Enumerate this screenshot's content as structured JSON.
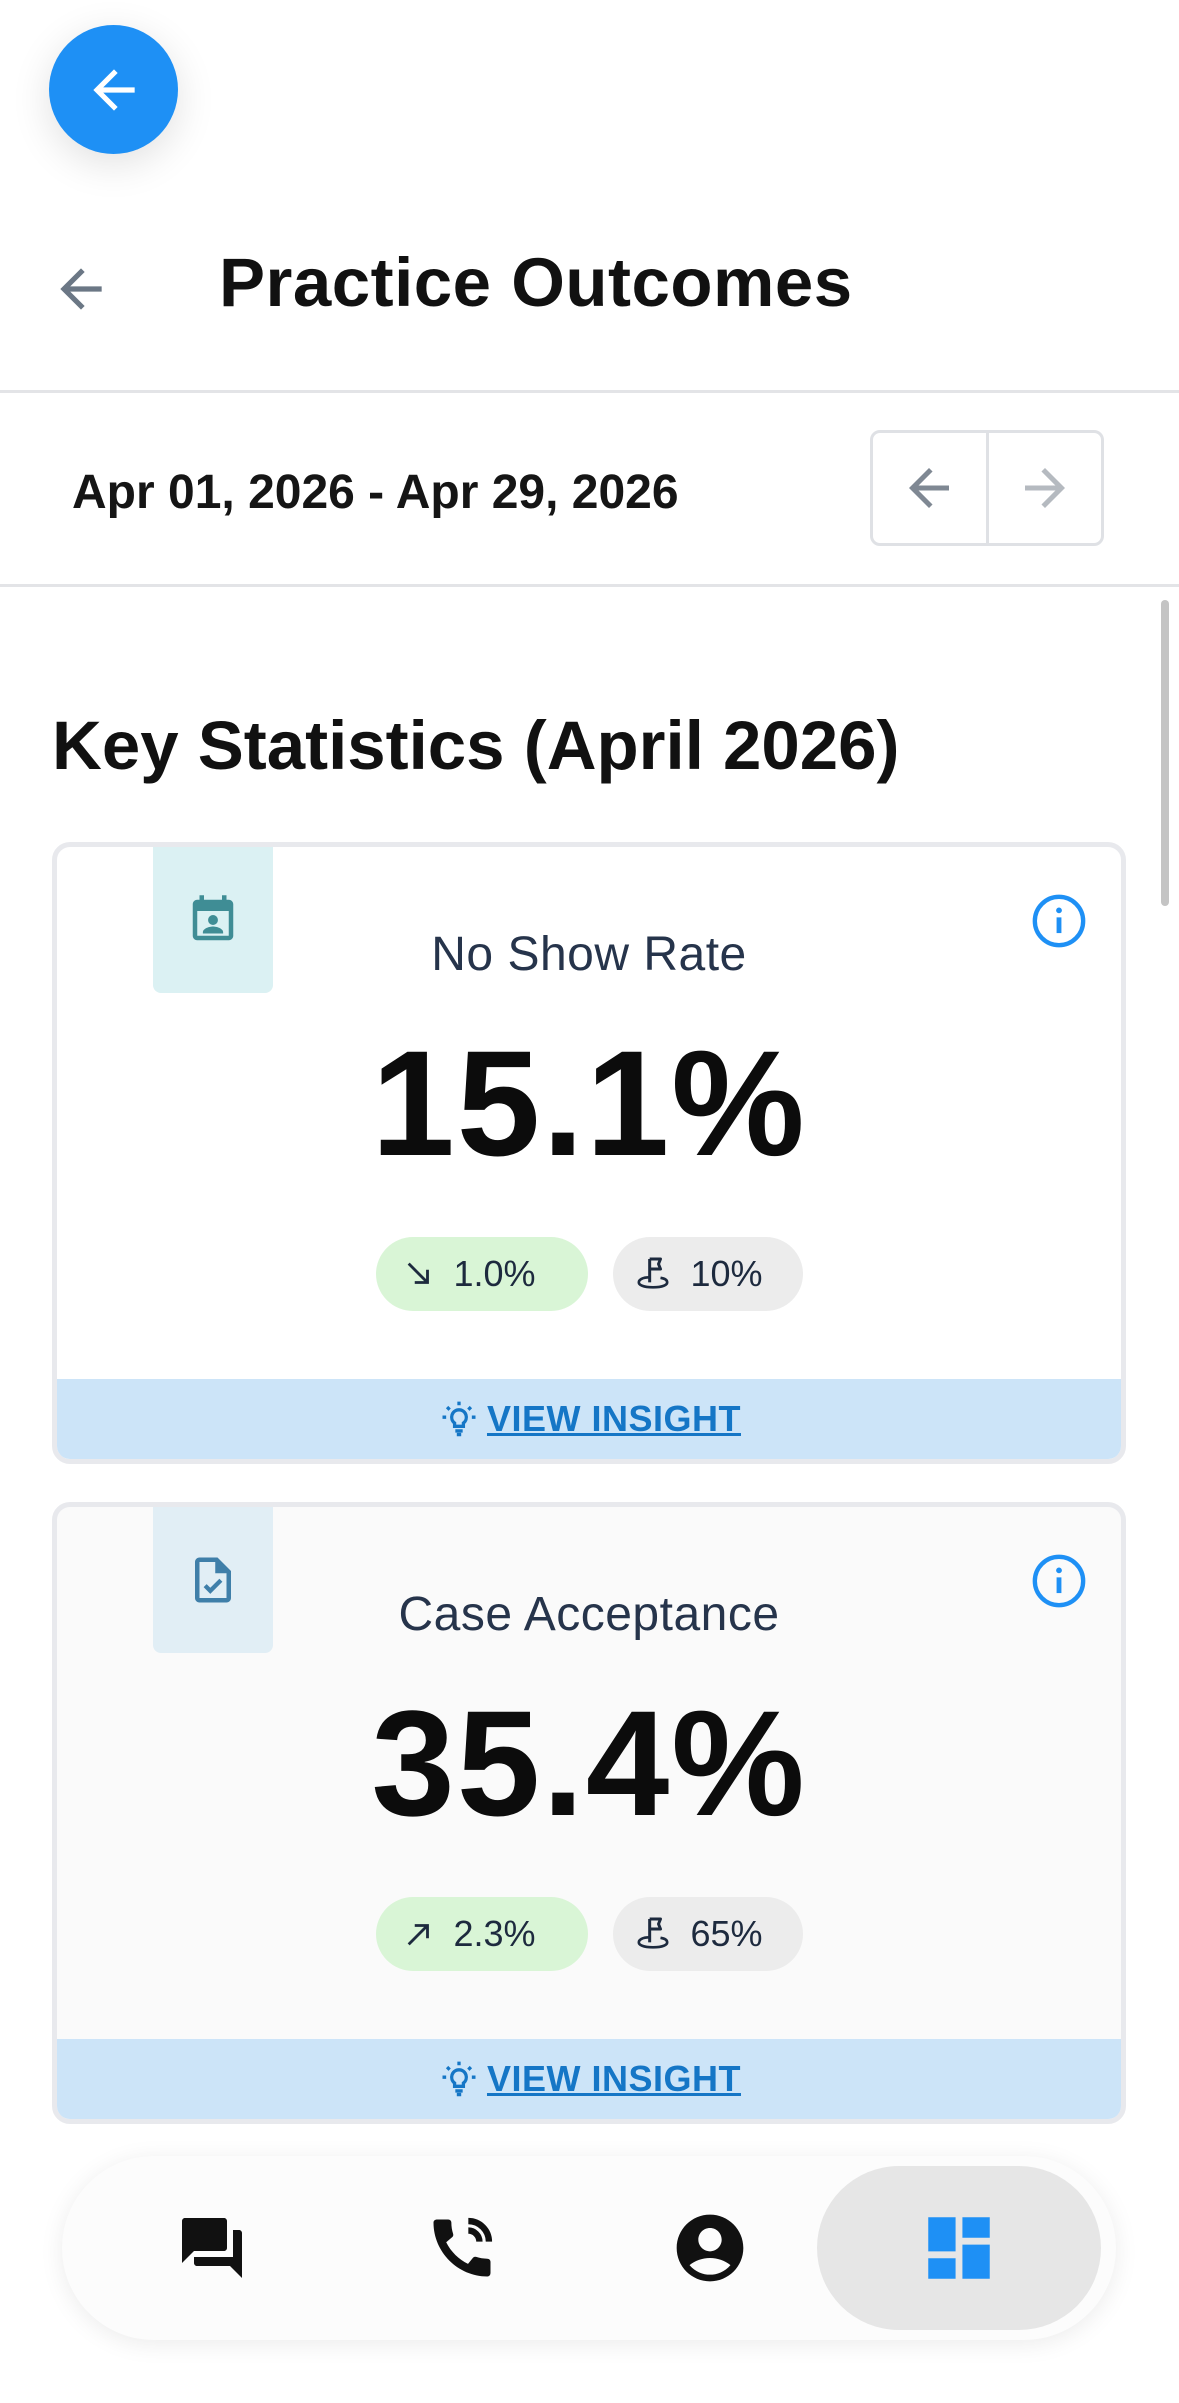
{
  "header": {
    "title": "Practice Outcomes"
  },
  "date_range": {
    "label": "Apr 01, 2026 - Apr 29, 2026"
  },
  "section": {
    "title": "Key Statistics (April 2026)"
  },
  "cards": [
    {
      "label": "No Show Rate",
      "value": "15.1%",
      "trend": "1.0%",
      "trend_direction": "down",
      "goal": "10%",
      "insight_label": "VIEW INSIGHT",
      "icon": "calendar-person-icon"
    },
    {
      "label": "Case Acceptance",
      "value": "35.4%",
      "trend": "2.3%",
      "trend_direction": "up",
      "goal": "65%",
      "insight_label": "VIEW INSIGHT",
      "icon": "file-check-icon"
    }
  ],
  "bottom_nav": [
    {
      "icon": "chat-icon",
      "active": false
    },
    {
      "icon": "phone-call-icon",
      "active": false
    },
    {
      "icon": "account-icon",
      "active": false
    },
    {
      "icon": "dashboard-icon",
      "active": true
    }
  ],
  "colors": {
    "accent": "#1e90f5",
    "trend_bg": "#d9f5d6",
    "insight_bg": "#cce4f8",
    "insight_text": "#1576c6"
  }
}
